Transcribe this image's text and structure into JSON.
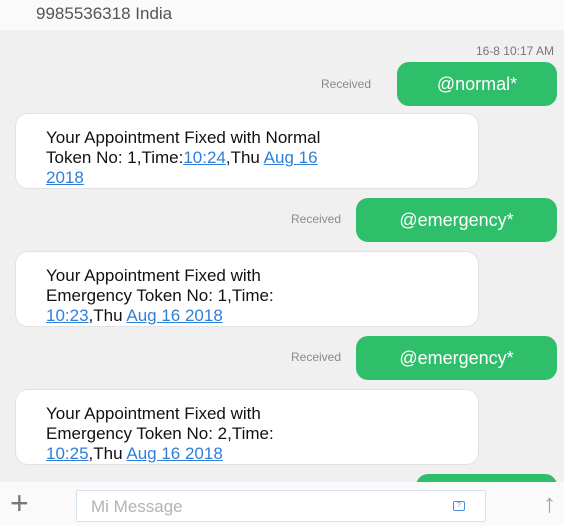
{
  "header": {
    "title": "9985536318 India"
  },
  "conversation": {
    "timestamp": "16-8 10:17 AM",
    "messages": [
      {
        "direction": "out",
        "status": "Received",
        "text": "@normal*"
      },
      {
        "direction": "in",
        "lines": [
          [
            {
              "text": "Your Appointment Fixed with  Normal",
              "link": false
            }
          ],
          [
            {
              "text": "Token No: 1,Time:",
              "link": false
            },
            {
              "text": "10:24",
              "link": true
            },
            {
              "text": ",Thu ",
              "link": false
            },
            {
              "text": "Aug 16",
              "link": true
            }
          ],
          [
            {
              "text": "2018",
              "link": true
            }
          ]
        ]
      },
      {
        "direction": "out",
        "status": "Received",
        "text": "@emergency*"
      },
      {
        "direction": "in",
        "lines": [
          [
            {
              "text": "Your Appointment Fixed with",
              "link": false
            }
          ],
          [
            {
              "text": "Emergency Token No: 1,Time:",
              "link": false
            }
          ],
          [
            {
              "text": "10:23",
              "link": true
            },
            {
              "text": ",Thu ",
              "link": false
            },
            {
              "text": "Aug 16 2018",
              "link": true
            }
          ]
        ]
      },
      {
        "direction": "out",
        "status": "Received",
        "text": "@emergency*"
      },
      {
        "direction": "in",
        "lines": [
          [
            {
              "text": "Your Appointment Fixed with",
              "link": false
            }
          ],
          [
            {
              "text": "Emergency Token No: 2,Time:",
              "link": false
            }
          ],
          [
            {
              "text": "10:25",
              "link": true
            },
            {
              "text": ",Thu ",
              "link": false
            },
            {
              "text": "Aug 16 2018",
              "link": true
            }
          ]
        ]
      }
    ]
  },
  "composer": {
    "placeholder": "Mi Message",
    "add_icon": "plus-icon",
    "sticker_icon": "sticker-icon",
    "send_icon": "send-arrow-icon"
  },
  "colors": {
    "sent_bubble": "#2fbe6a",
    "link": "#2f7fd9"
  }
}
